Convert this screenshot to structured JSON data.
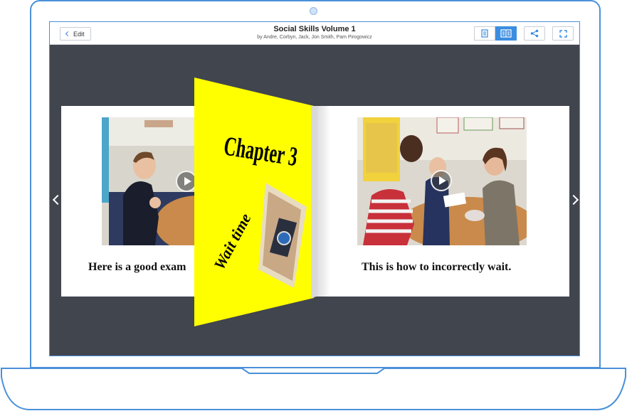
{
  "toolbar": {
    "edit_label": "Edit",
    "title": "Social Skills Volume 1",
    "authors": "by Andre, Corbyn, Jack, Jon Smith, Pam Pirogowicz"
  },
  "icons": {
    "single_page_view": "single-page-icon",
    "two_page_view": "two-page-icon",
    "share": "share-icon",
    "fullscreen": "fullscreen-icon"
  },
  "left_page": {
    "caption": "Here is a good exam"
  },
  "right_page": {
    "caption": "This is how to incorrectly wait."
  },
  "flip_page": {
    "heading": "Chapter 3",
    "subtitle": "Wait time"
  },
  "colors": {
    "accent": "#3b8de0",
    "screen_bg": "#41454e",
    "flip_page": "#ffff00",
    "frame": "#4a90d9"
  }
}
